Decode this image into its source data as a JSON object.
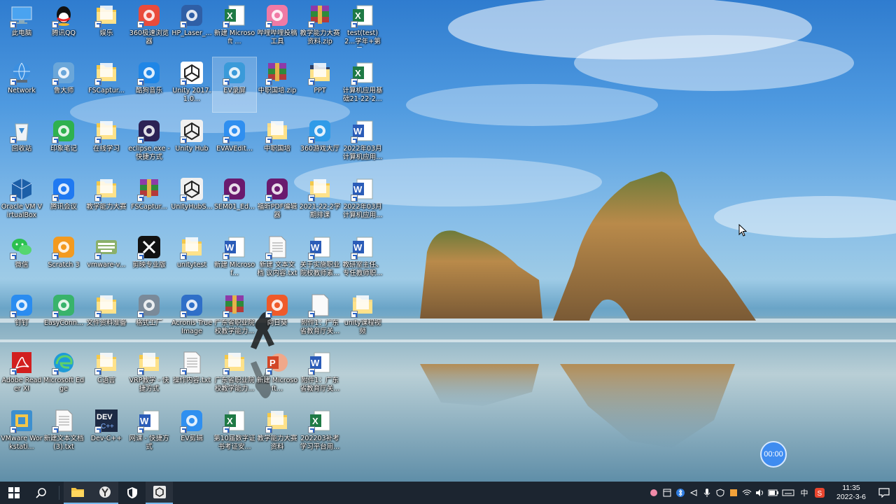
{
  "desktop": {
    "icons": [
      {
        "label": "此电脑",
        "icon": "computer-icon",
        "color": "#4aa3f0"
      },
      {
        "label": "腾讯QQ",
        "icon": "qq-icon",
        "color": "#111111"
      },
      {
        "label": "娱乐",
        "icon": "folder-icon",
        "color": "#f4c84a"
      },
      {
        "label": "360极速浏览器",
        "icon": "browser-360-icon",
        "color": "#e94b3c"
      },
      {
        "label": "HP_Laser_...",
        "icon": "printer-app-icon",
        "color": "#2f5fa6"
      },
      {
        "label": "新建 Microsoft ...",
        "icon": "excel-icon",
        "color": "#1f7a45"
      },
      {
        "label": "哔哩哔哩投稿工具",
        "icon": "bilibili-icon",
        "color": "#f07aa5"
      },
      {
        "label": "教学能力大赛资料.zip",
        "icon": "winrar-icon",
        "color": "#b33a3a"
      },
      {
        "label": "test(test) 2...学年+第二...",
        "icon": "excel-icon",
        "color": "#1f7a45"
      },
      {
        "label": "Network",
        "icon": "network-icon",
        "color": "#3b8fe0"
      },
      {
        "label": "鲁大师",
        "icon": "ludashi-icon",
        "color": "#6aa6d9"
      },
      {
        "label": "FSCaptur...",
        "icon": "folder-icon",
        "color": "#f4c84a"
      },
      {
        "label": "酷狗音乐",
        "icon": "kugou-icon",
        "color": "#1f86e6"
      },
      {
        "label": "Unity 2017.1.0...",
        "icon": "unity-icon",
        "color": "#222222"
      },
      {
        "label": "EV录屏",
        "icon": "ev-record-icon",
        "color": "#3a9ad9"
      },
      {
        "label": "中职国培.zip",
        "icon": "winrar-icon",
        "color": "#b33a3a"
      },
      {
        "label": "PPT",
        "icon": "folder-icon",
        "color": "#2c3e66"
      },
      {
        "label": "计算机应用基础21-22-2...",
        "icon": "excel-icon",
        "color": "#1f7a45"
      },
      {
        "label": "回收站",
        "icon": "recycle-bin-icon",
        "color": "#cfd8e3"
      },
      {
        "label": "印象笔记",
        "icon": "evernote-icon",
        "color": "#2fb14f"
      },
      {
        "label": "在线学习",
        "icon": "folder-icon",
        "color": "#f4c84a"
      },
      {
        "label": "eclipse.exe - 快捷方式",
        "icon": "eclipse-icon",
        "color": "#2c2255"
      },
      {
        "label": "Unity Hub",
        "icon": "unity-hub-icon",
        "color": "#222222"
      },
      {
        "label": "EVAVEdit...",
        "icon": "ev-edit-icon",
        "color": "#2f8ff0"
      },
      {
        "label": "中职国培",
        "icon": "folder-icon",
        "color": "#f4d98a"
      },
      {
        "label": "360游戏大厅",
        "icon": "game-360-icon",
        "color": "#2f9be8"
      },
      {
        "label": "2022年03月计算机应用...",
        "icon": "word-icon",
        "color": "#2b5cb8"
      },
      {
        "label": "Oracle VM VirtualBox",
        "icon": "virtualbox-icon",
        "color": "#1c5fa8"
      },
      {
        "label": "腾讯会议",
        "icon": "tencent-meeting-icon",
        "color": "#1f79f2"
      },
      {
        "label": "教学能力大赛",
        "icon": "folder-icon",
        "color": "#f4c84a"
      },
      {
        "label": "FSCaptur...",
        "icon": "winrar-icon",
        "color": "#b33a3a"
      },
      {
        "label": "UnityHubS...",
        "icon": "unity-hub-icon",
        "color": "#222222"
      },
      {
        "label": "SEM01_Ed...",
        "icon": "foxit-icon",
        "color": "#6a1a6e"
      },
      {
        "label": "福昕PDF编辑器",
        "icon": "foxit-pdf-icon",
        "color": "#6a1a6e"
      },
      {
        "label": "2021-22-2学期排课",
        "icon": "folder-icon",
        "color": "#f4c84a"
      },
      {
        "label": "2022年03月计算机应用...",
        "icon": "word-icon",
        "color": "#2b5cb8"
      },
      {
        "label": "微信",
        "icon": "wechat-icon",
        "color": "#2bc04f"
      },
      {
        "label": "Scratch 3",
        "icon": "scratch-icon",
        "color": "#f39a1f"
      },
      {
        "label": "vmware-v...",
        "icon": "keyboard-icon",
        "color": "#8bb06a"
      },
      {
        "label": "剪映专业版",
        "icon": "jianying-icon",
        "color": "#111111"
      },
      {
        "label": "unitytest",
        "icon": "folder-icon",
        "color": "#f4c84a"
      },
      {
        "label": "新建 Microsof...",
        "icon": "word-icon",
        "color": "#2b5cb8"
      },
      {
        "label": "新建 文本文档 议内容.txt",
        "icon": "text-file-icon",
        "color": "#eeeeee"
      },
      {
        "label": "关于实施职业院校教师素...",
        "icon": "word-icon",
        "color": "#2b5cb8"
      },
      {
        "label": "教研室主任、专任教师职...",
        "icon": "word-icon",
        "color": "#2b5cb8"
      },
      {
        "label": "钉钉",
        "icon": "dingtalk-icon",
        "color": "#2a8cf0"
      },
      {
        "label": "EasyConn...",
        "icon": "easyconnect-icon",
        "color": "#38b36b"
      },
      {
        "label": "文件资料准备",
        "icon": "folder-icon",
        "color": "#f4c84a"
      },
      {
        "label": "格式工厂",
        "icon": "format-factory-icon",
        "color": "#7a8a99"
      },
      {
        "label": "Acronis True Image",
        "icon": "acronis-icon",
        "color": "#2f6fc8"
      },
      {
        "label": "广东省职业院校教学能力...",
        "icon": "winrar-icon",
        "color": "#b33a3a"
      },
      {
        "label": "向日葵",
        "icon": "sunlogin-icon",
        "color": "#ef5a2a"
      },
      {
        "label": "附件1：广东省教育厅关...",
        "icon": "blank-file-icon",
        "color": "#f4f4f4"
      },
      {
        "label": "unity课程视频",
        "icon": "folder-icon",
        "color": "#f4d98a"
      },
      {
        "label": "Adobe Reader XI",
        "icon": "adobe-reader-icon",
        "color": "#d21f1f"
      },
      {
        "label": "Microsoft Edge",
        "icon": "edge-icon",
        "color": "#1e9bd7"
      },
      {
        "label": "C语言",
        "icon": "folder-icon",
        "color": "#f4c84a"
      },
      {
        "label": "VRP教学 - 快捷方式",
        "icon": "folder-icon",
        "color": "#f4c84a"
      },
      {
        "label": "操作内容.txt",
        "icon": "text-file-icon",
        "color": "#eeeeee"
      },
      {
        "label": "广东省职业院校教学能力...",
        "icon": "folder-icon",
        "color": "#f4c84a"
      },
      {
        "label": "新建 Microsoft...",
        "icon": "powerpoint-icon",
        "color": "#d24726"
      },
      {
        "label": "附件1：广东省教育厅关...",
        "icon": "word-icon",
        "color": "#2b5cb8"
      },
      {
        "label": "VMware Workstati...",
        "icon": "vmware-icon",
        "color": "#3c8fcf"
      },
      {
        "label": "新建文本文档 (3).txt",
        "icon": "text-file-icon",
        "color": "#eeeeee"
      },
      {
        "label": "Dev-C++",
        "icon": "devcpp-icon",
        "color": "#1d2a44"
      },
      {
        "label": "网课 - 快捷方式",
        "icon": "word-icon",
        "color": "#2b5cb8"
      },
      {
        "label": "EV剪辑",
        "icon": "ev-edit-icon",
        "color": "#2f8ff0"
      },
      {
        "label": "第10届数字证书考证安...",
        "icon": "excel-icon",
        "color": "#1f7a45"
      },
      {
        "label": "教学能力大赛资料",
        "icon": "folder-icon",
        "color": "#f4c84a"
      },
      {
        "label": "202203补考学习平台用...",
        "icon": "excel-icon",
        "color": "#1f7a45"
      }
    ]
  },
  "timer": {
    "label": "00:00"
  },
  "taskbar": {
    "pinned": [
      {
        "name": "start-button",
        "icon": "windows-logo-icon"
      },
      {
        "name": "search-button",
        "icon": "search-icon"
      },
      {
        "name": "file-explorer-button",
        "icon": "folder-icon"
      },
      {
        "name": "app-y-button",
        "icon": "y-app-icon"
      },
      {
        "name": "security-button",
        "icon": "shield-icon"
      },
      {
        "name": "unity-button",
        "icon": "unity-icon"
      }
    ],
    "tray": {
      "input_lang": "中",
      "time": "11:35",
      "date": "2022-3-6"
    }
  }
}
